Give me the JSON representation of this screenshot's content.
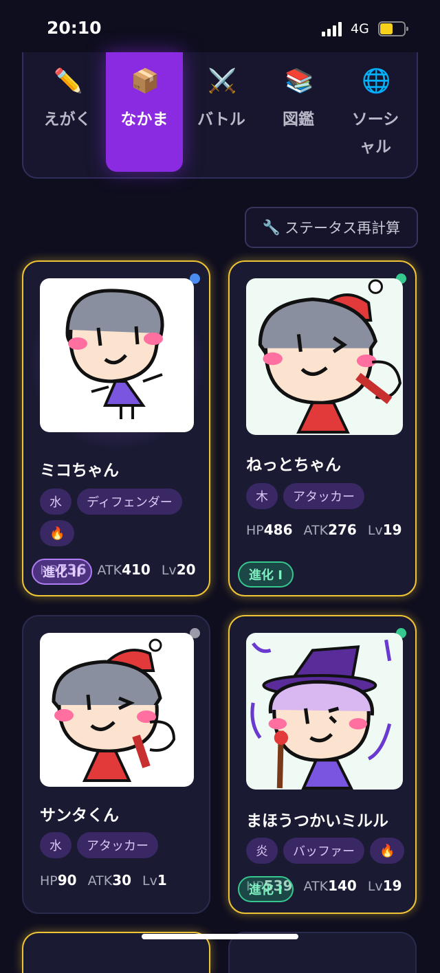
{
  "status_bar": {
    "time": "20:10",
    "network": "4G"
  },
  "nav": [
    {
      "label": "えがく",
      "icon": "✏️"
    },
    {
      "label": "なかま",
      "icon": "📦",
      "active": true
    },
    {
      "label": "バトル",
      "icon": "⚔️"
    },
    {
      "label": "図鑑",
      "icon": "📚"
    },
    {
      "label": "ソーシャル",
      "icon": "🌐"
    }
  ],
  "recalc_button": {
    "icon": "🔧",
    "label": "ステータス再計算"
  },
  "cards": [
    {
      "name": "ミコちゃん",
      "tags": [
        "水",
        "ディフェンダー",
        "🔥"
      ],
      "hp_label": "HP",
      "hp": "736",
      "atk_label": "ATK",
      "atk": "410",
      "lv_label": "Lv",
      "lv": "20",
      "evolution": "進化 II",
      "dot_color": "#4a8cf0"
    },
    {
      "name": "ねっとちゃん",
      "tags": [
        "木",
        "アタッカー"
      ],
      "hp_label": "HP",
      "hp": "486",
      "atk_label": "ATK",
      "atk": "276",
      "lv_label": "Lv",
      "lv": "19",
      "evolution": "進化 I",
      "dot_color": "#35c88f"
    },
    {
      "name": "サンタくん",
      "tags": [
        "水",
        "アタッカー"
      ],
      "hp_label": "HP",
      "hp": "90",
      "atk_label": "ATK",
      "atk": "30",
      "lv_label": "Lv",
      "lv": "1",
      "dot_color": "#9a9aa8"
    },
    {
      "name": "まほうつかいミルル",
      "tags": [
        "炎",
        "バッファー",
        "🔥"
      ],
      "hp_label": "HP",
      "hp": "539",
      "atk_label": "ATK",
      "atk": "140",
      "lv_label": "Lv",
      "lv": "19",
      "evolution": "進化 I",
      "dot_color": "#35c88f"
    }
  ]
}
